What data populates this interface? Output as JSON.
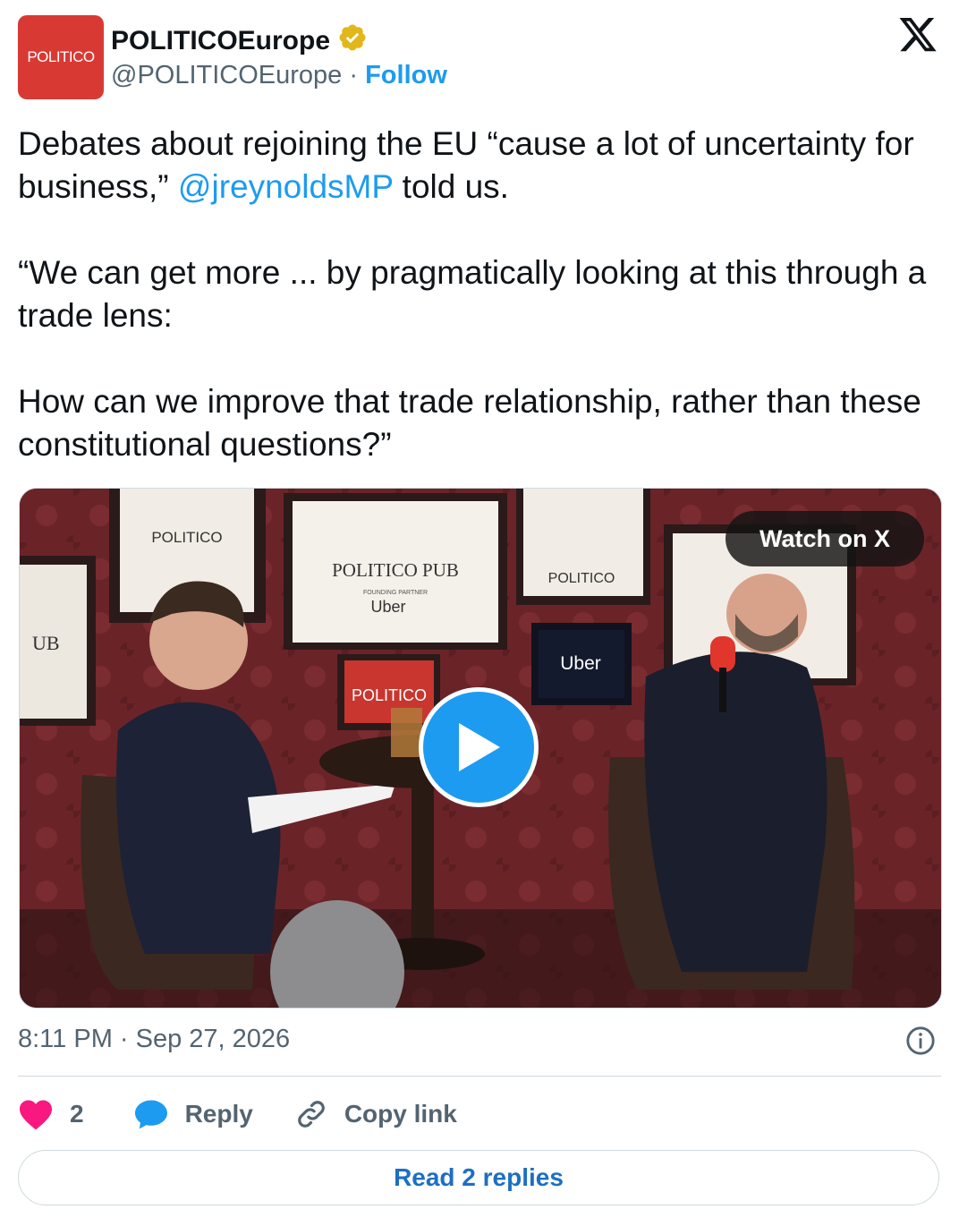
{
  "account": {
    "avatar_text": "POLITICO",
    "display_name": "POLITICOEurope",
    "handle": "@POLITICOEurope",
    "separator": " · ",
    "follow_label": "Follow",
    "verified": true
  },
  "tweet": {
    "line1_before": "Debates about rejoining the EU “cause a lot of uncertainty for business,” ",
    "mention": "@jreynoldsMP",
    "line1_after": " told us.",
    "paragraph2": "“We can get more ... by pragmatically looking at this through a trade lens:",
    "paragraph3": "How can we improve that trade relationship, rather than these constitutional questions?”"
  },
  "video": {
    "watch_label": "Watch on X",
    "scene_signs": {
      "pub_sign": "POLITICO PUB",
      "founding_partner": "FOUNDING PARTNER",
      "uber": "Uber",
      "politico": "POLITICO",
      "ub_fragment": "UB"
    }
  },
  "meta": {
    "timestamp": "8:11 PM · Sep 27, 2026"
  },
  "actions": {
    "like_count": "2",
    "reply_label": "Reply",
    "copy_link_label": "Copy link"
  },
  "read_replies_label": "Read 2 replies",
  "colors": {
    "brand_red": "#d83a33",
    "link_blue": "#1d9bf0",
    "like_pink": "#f91880",
    "muted": "#536471"
  },
  "icons": [
    "verified-badge-icon",
    "x-logo-icon",
    "play-icon",
    "info-icon",
    "heart-icon",
    "reply-bubble-icon",
    "link-icon"
  ]
}
